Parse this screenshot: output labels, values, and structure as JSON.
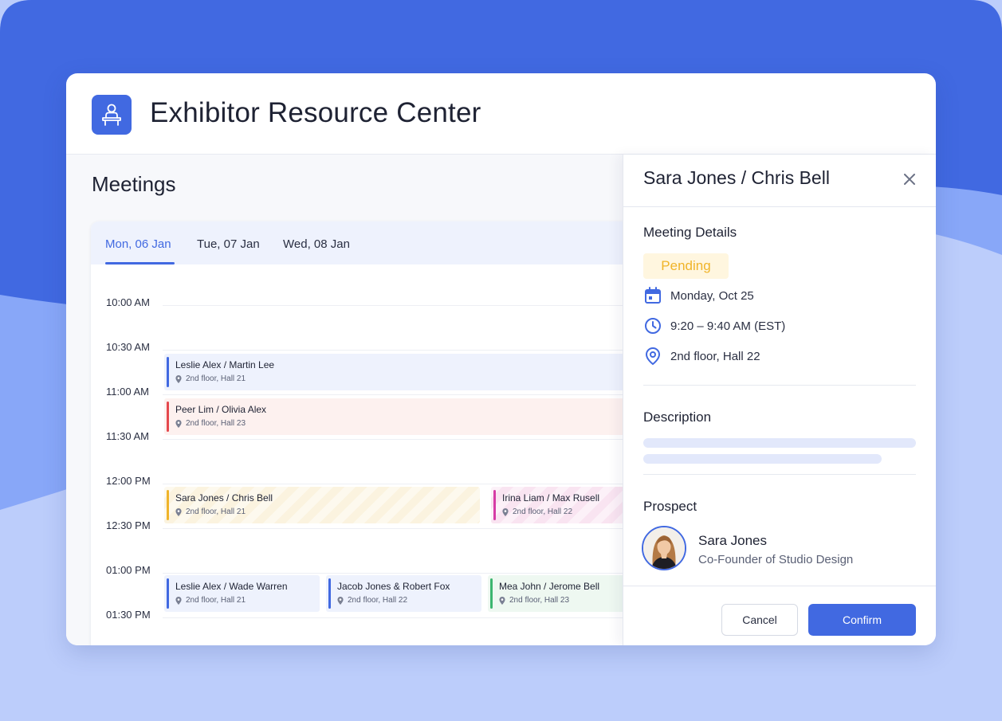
{
  "app": {
    "title": "Exhibitor Resource Center",
    "logo_icon": "presenter-podium-icon",
    "accent_color": "#4169e1"
  },
  "meetings": {
    "page_title": "Meetings",
    "tabs": [
      {
        "label": "Mon, 06 Jan",
        "active": true
      },
      {
        "label": "Tue, 07 Jan",
        "active": false
      },
      {
        "label": "Wed, 08 Jan",
        "active": false
      }
    ],
    "time_slots": [
      "10:00 AM",
      "10:30 AM",
      "11:00 AM",
      "11:30 AM",
      "12:00 PM",
      "12:30 PM",
      "01:00 PM",
      "01:30 PM"
    ],
    "events": [
      {
        "title": "Leslie Alex  / Martin Lee",
        "location": "2nd floor, Hall 21",
        "color": "#4169e1"
      },
      {
        "title": "Peer Lim / Olivia Alex",
        "location": "2nd floor, Hall 23",
        "color": "#e5484d"
      },
      {
        "title": "Sara Jones / Chris Bell",
        "location": "2nd floor, Hall 21",
        "color": "#f0b429"
      },
      {
        "title": "Irina Liam / Max Rusell",
        "location": "2nd floor, Hall 22",
        "color": "#d63ca6"
      },
      {
        "title": "Leslie Alex / Wade Warren",
        "location": "2nd floor, Hall 21",
        "color": "#4169e1"
      },
      {
        "title": "Jacob Jones & Robert Fox",
        "location": "2nd floor, Hall 22",
        "color": "#4169e1"
      },
      {
        "title": "Mea John / Jerome Bell",
        "location": "2nd floor, Hall 23",
        "color": "#3cb66f"
      }
    ]
  },
  "detail": {
    "title": "Sara Jones / Chris Bell",
    "close_icon": "close-icon",
    "meeting_details_label": "Meeting Details",
    "status": "Pending",
    "status_color": "#f0b429",
    "date": "Monday, Oct 25",
    "time": "9:20 – 9:40 AM (EST)",
    "location": "2nd floor, Hall 22",
    "description_label": "Description",
    "prospect_label": "Prospect",
    "prospect": {
      "name": "Sara Jones",
      "role": "Co-Founder of Studio Design"
    },
    "cancel_label": "Cancel",
    "confirm_label": "Confirm"
  }
}
